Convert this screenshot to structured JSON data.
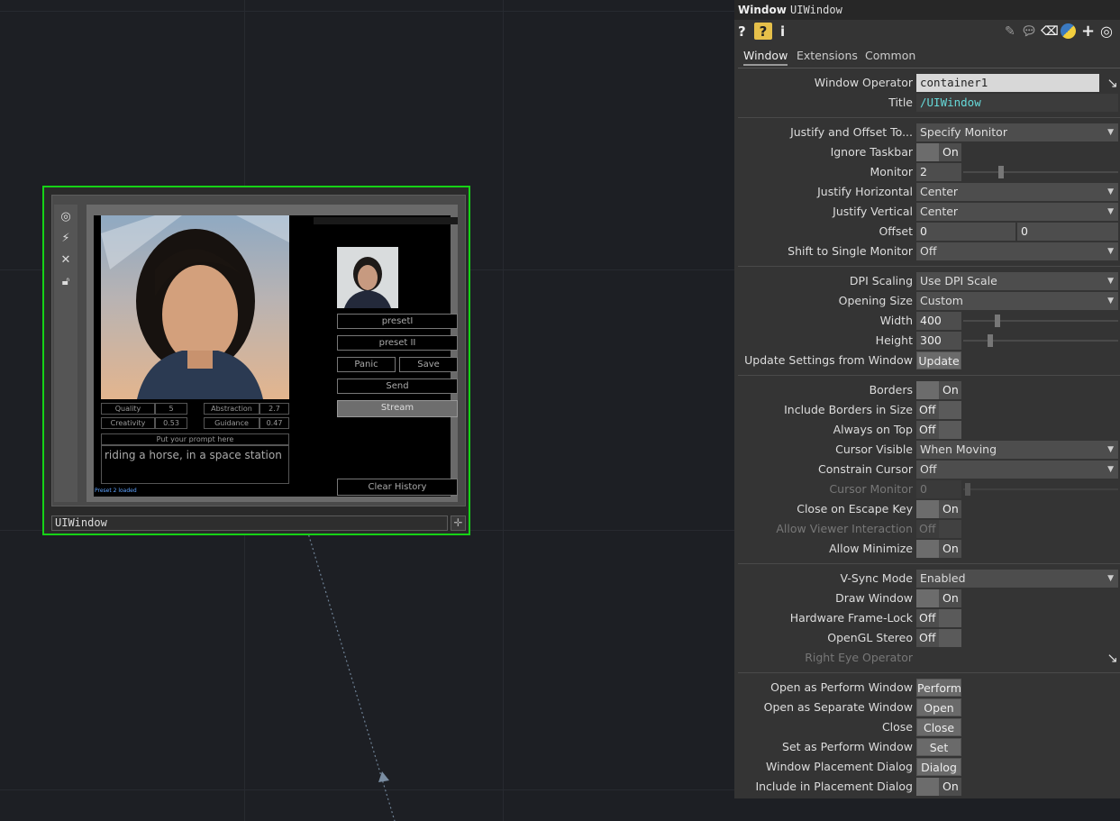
{
  "network": {
    "node_name": "UIWindow",
    "ui": {
      "buttons": [
        "presetI",
        "preset II",
        "Panic",
        "Save",
        "Send",
        "Stream",
        "Clear History"
      ],
      "params": [
        {
          "label": "Quality",
          "value": "5"
        },
        {
          "label": "Abstraction",
          "value": "2.7"
        },
        {
          "label": "Creativity",
          "value": "0.53"
        },
        {
          "label": "Guidance",
          "value": "0.47"
        }
      ],
      "prompt_label": "Put your prompt here",
      "prompt_text": "riding a horse, in a space station",
      "status": "Preset 2 loaded"
    }
  },
  "panel": {
    "header_type": "Window",
    "header_name": "UIWindow",
    "toolbar": {
      "help": "?",
      "info": "i"
    },
    "tabs": [
      "Window",
      "Extensions",
      "Common"
    ],
    "params": {
      "window_operator": {
        "label": "Window Operator",
        "value": "container1"
      },
      "title": {
        "label": "Title",
        "value": "/UIWindow"
      },
      "justify_offset": {
        "label": "Justify and Offset To...",
        "value": "Specify Monitor"
      },
      "ignore_taskbar": {
        "label": "Ignore Taskbar",
        "value": "On"
      },
      "monitor": {
        "label": "Monitor",
        "value": "2"
      },
      "justify_h": {
        "label": "Justify Horizontal",
        "value": "Center"
      },
      "justify_v": {
        "label": "Justify Vertical",
        "value": "Center"
      },
      "offset": {
        "label": "Offset",
        "x": "0",
        "y": "0"
      },
      "shift_single": {
        "label": "Shift to Single Monitor",
        "value": "Off"
      },
      "dpi_scaling": {
        "label": "DPI Scaling",
        "value": "Use DPI Scale"
      },
      "opening_size": {
        "label": "Opening Size",
        "value": "Custom"
      },
      "width": {
        "label": "Width",
        "value": "400"
      },
      "height": {
        "label": "Height",
        "value": "300"
      },
      "update_settings": {
        "label": "Update Settings from Window",
        "value": "Update"
      },
      "borders": {
        "label": "Borders",
        "value": "On"
      },
      "include_borders": {
        "label": "Include Borders in Size",
        "value": "Off"
      },
      "always_on_top": {
        "label": "Always on Top",
        "value": "Off"
      },
      "cursor_visible": {
        "label": "Cursor Visible",
        "value": "When Moving"
      },
      "constrain_cursor": {
        "label": "Constrain Cursor",
        "value": "Off"
      },
      "cursor_monitor": {
        "label": "Cursor Monitor",
        "value": "0"
      },
      "close_escape": {
        "label": "Close on Escape Key",
        "value": "On"
      },
      "allow_viewer": {
        "label": "Allow Viewer Interaction",
        "value": "Off"
      },
      "allow_minimize": {
        "label": "Allow Minimize",
        "value": "On"
      },
      "vsync": {
        "label": "V-Sync Mode",
        "value": "Enabled"
      },
      "draw_window": {
        "label": "Draw Window",
        "value": "On"
      },
      "hw_framelock": {
        "label": "Hardware Frame-Lock",
        "value": "Off"
      },
      "opengl_stereo": {
        "label": "OpenGL Stereo",
        "value": "Off"
      },
      "right_eye": {
        "label": "Right Eye Operator",
        "value": ""
      },
      "open_perform": {
        "label": "Open as Perform Window",
        "value": "Perform"
      },
      "open_separate": {
        "label": "Open as Separate Window",
        "value": "Open"
      },
      "close": {
        "label": "Close",
        "value": "Close"
      },
      "set_perform": {
        "label": "Set as Perform Window",
        "value": "Set"
      },
      "placement_dialog": {
        "label": "Window Placement Dialog",
        "value": "Dialog"
      },
      "include_placement": {
        "label": "Include in Placement Dialog",
        "value": "On"
      }
    }
  }
}
